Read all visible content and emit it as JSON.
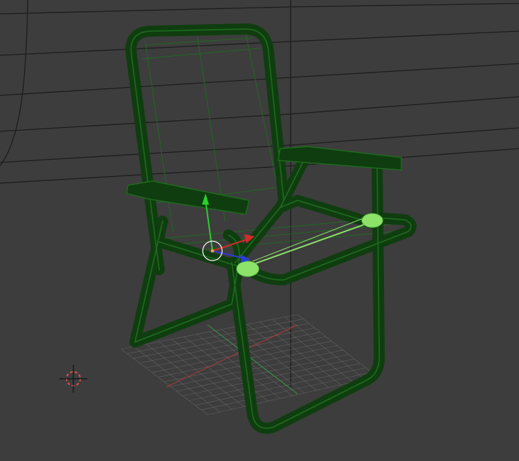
{
  "viewport": {
    "view": "3D Viewport",
    "background": "#3d3d3d",
    "grid_color": "#7a7a7a",
    "axis_x_color": "#b03a3a",
    "axis_y_color": "#3a9a4a"
  },
  "object": {
    "kind": "wireframe-mesh",
    "depicts": "folding-lawn-chair",
    "frame_color": "#0f3d0f",
    "wire_color": "#1e6b1e",
    "selected_color": "#8de36a"
  },
  "gizmo": {
    "x_color": "#d42a2a",
    "y_color": "#2bd12b",
    "z_color": "#2a3cd4",
    "center_color": "#e0e0e0"
  },
  "cursor_3d": {
    "ring_color": "#e05050",
    "cross_color": "#111111"
  }
}
